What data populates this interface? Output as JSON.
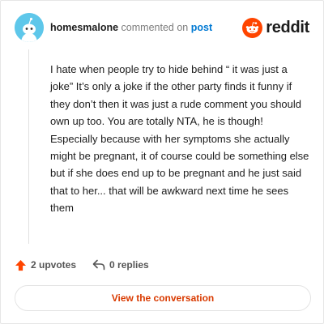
{
  "header": {
    "username": "homesmalone",
    "action_text": "commented on",
    "link_text": "post",
    "logo_text": "reddit"
  },
  "comment": {
    "text": "I hate when people try to hide behind “ it was just a joke” It’s only a joke if the other party finds it funny if they don’t then it was just a rude comment you should own up too. You are totally NTA, he is though! Especially because with her symptoms she actually might be pregnant, it of course could be something else but if she does end up to be pregnant and he just said that to her... that will be awkward next time he sees them"
  },
  "actions": {
    "upvotes": "2 upvotes",
    "replies": "0 replies"
  },
  "cta": {
    "label": "View the conversation"
  },
  "colors": {
    "brand": "#ff4500",
    "link": "#0079d3",
    "cta_text": "#d93a00",
    "avatar_bg": "#5ec7ea"
  },
  "icons": [
    "avatar-snoo-icon",
    "reddit-logo-icon",
    "upvote-arrow-icon",
    "reply-arrow-icon"
  ]
}
